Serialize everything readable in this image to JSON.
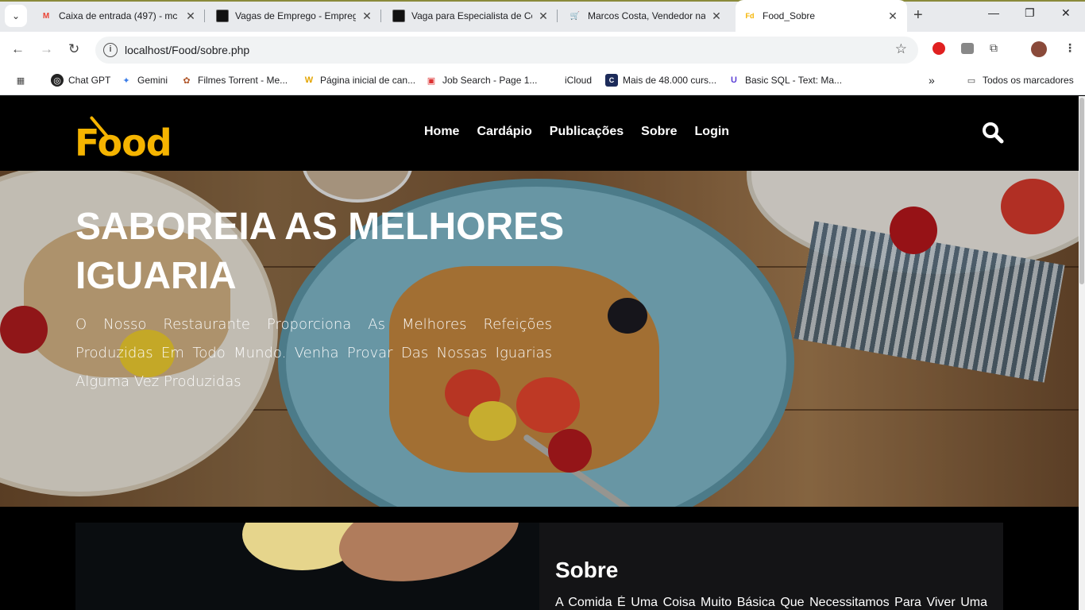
{
  "browser": {
    "tabs": [
      {
        "title": "Caixa de entrada (497) - mc",
        "favicon": "gmail-icon"
      },
      {
        "title": "Vagas de Emprego - Empreg",
        "favicon": "site-icon"
      },
      {
        "title": "Vaga para Especialista de Co",
        "favicon": "site-icon"
      },
      {
        "title": "Marcos Costa, Vendedor na",
        "favicon": "cart-icon"
      },
      {
        "title": "Food_Sobre",
        "favicon": "food-icon"
      }
    ],
    "active_tab": "Food_Sobre",
    "url": "localhost/Food/sobre.php",
    "bookmarks": [
      {
        "label": "Chat GPT",
        "icon": "chatgpt-icon"
      },
      {
        "label": "Gemini",
        "icon": "gemini-icon"
      },
      {
        "label": "Filmes Torrent - Me...",
        "icon": "torrent-icon"
      },
      {
        "label": "Página inicial de can...",
        "icon": "w-icon"
      },
      {
        "label": "Job Search - Page 1...",
        "icon": "job-icon"
      },
      {
        "label": "iCloud",
        "icon": "apple-icon"
      },
      {
        "label": "Mais de 48.000 curs...",
        "icon": "course-icon"
      },
      {
        "label": "Basic SQL - Text: Ma...",
        "icon": "u-icon"
      }
    ],
    "all_bookmarks_label": "Todos os marcadores"
  },
  "site": {
    "logo_text": "Food",
    "nav": [
      "Home",
      "Cardápio",
      "Publicações",
      "Sobre",
      "Login"
    ],
    "hero": {
      "title": "SABOREIA AS MELHORES IGUARIA",
      "text": "O Nosso Restaurante Proporciona As Melhores Refeições Produzidas Em Todo Mundo. Venha Provar Das Nossas Iguarias Alguma Vez Produzidas"
    },
    "about": {
      "title": "Sobre",
      "text": "A Comida É Uma Coisa Muito Básica Que Necessitamos Para Viver Uma"
    }
  },
  "colors": {
    "brand": "#f5b400",
    "header_bg": "#000000",
    "about_bg": "#141416"
  }
}
